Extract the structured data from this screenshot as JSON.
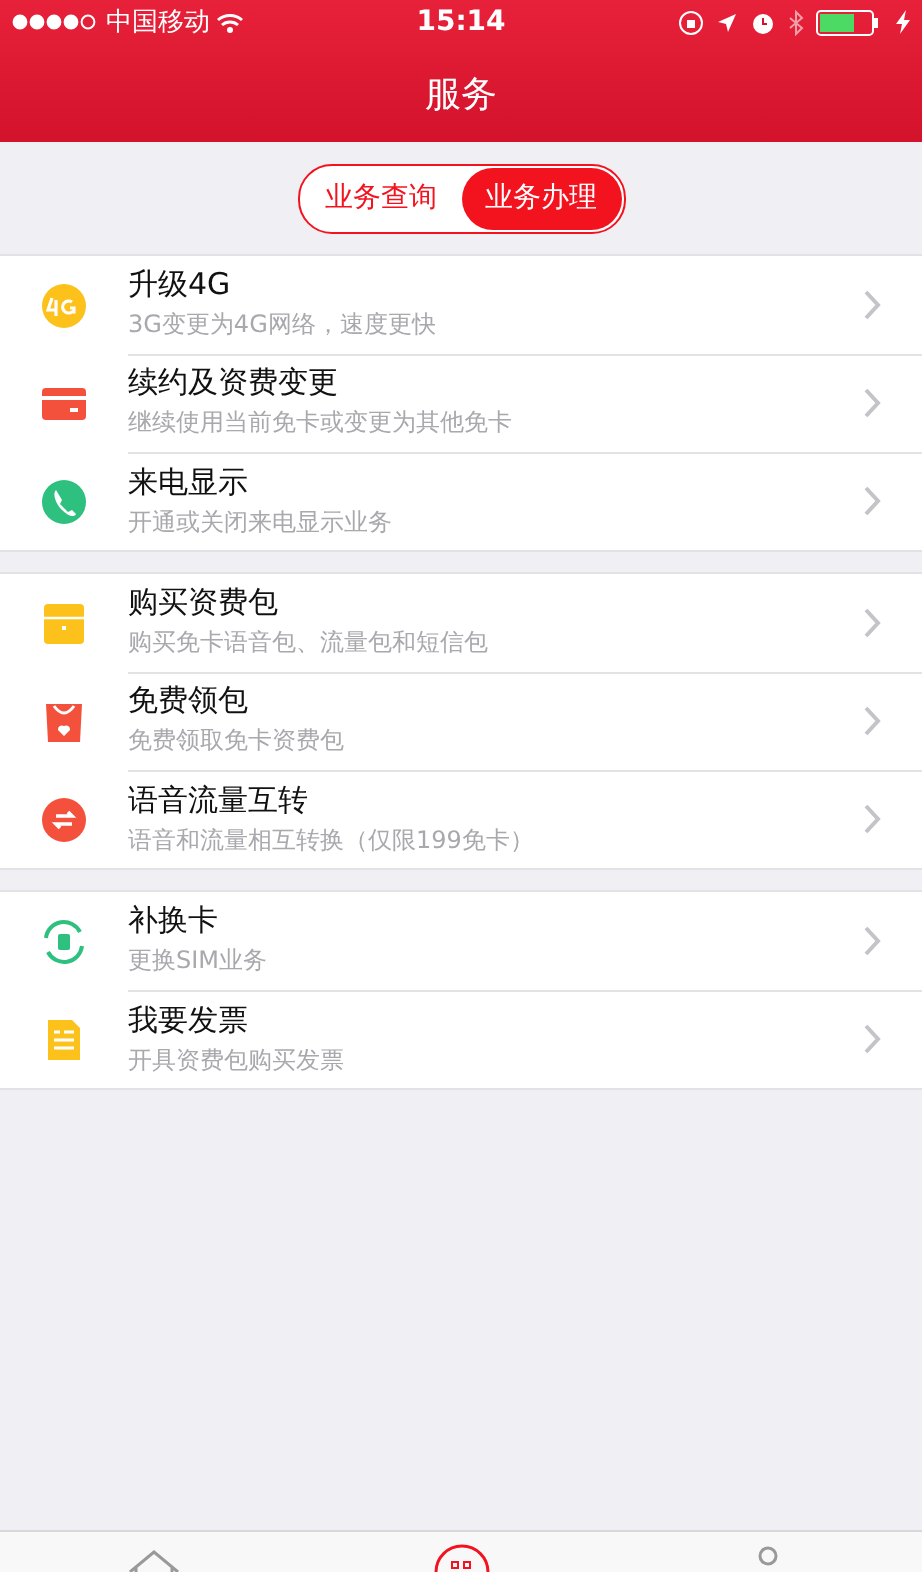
{
  "status_bar": {
    "carrier": "中国移动",
    "time": "15:14"
  },
  "nav": {
    "title": "服务"
  },
  "segments": [
    {
      "label": "业务查询",
      "selected": false
    },
    {
      "label": "业务办理",
      "selected": true
    }
  ],
  "groups": [
    [
      {
        "title": "升级4G",
        "subtitle": "3G变更为4G网络，速度更快"
      },
      {
        "title": "续约及资费变更",
        "subtitle": "继续使用当前免卡或变更为其他免卡"
      },
      {
        "title": "来电显示",
        "subtitle": "开通或关闭来电显示业务"
      }
    ],
    [
      {
        "title": "购买资费包",
        "subtitle": "购买免卡语音包、流量包和短信包"
      },
      {
        "title": "免费领包",
        "subtitle": "免费领取免卡资费包"
      },
      {
        "title": "语音流量互转",
        "subtitle": "语音和流量相互转换（仅限199免卡）"
      }
    ],
    [
      {
        "title": "补换卡",
        "subtitle": "更换SIM业务"
      },
      {
        "title": "我要发票",
        "subtitle": "开具资费包购买发票"
      }
    ]
  ],
  "tab_bar": [
    {
      "selected": false
    },
    {
      "selected": true
    },
    {
      "selected": false
    }
  ]
}
